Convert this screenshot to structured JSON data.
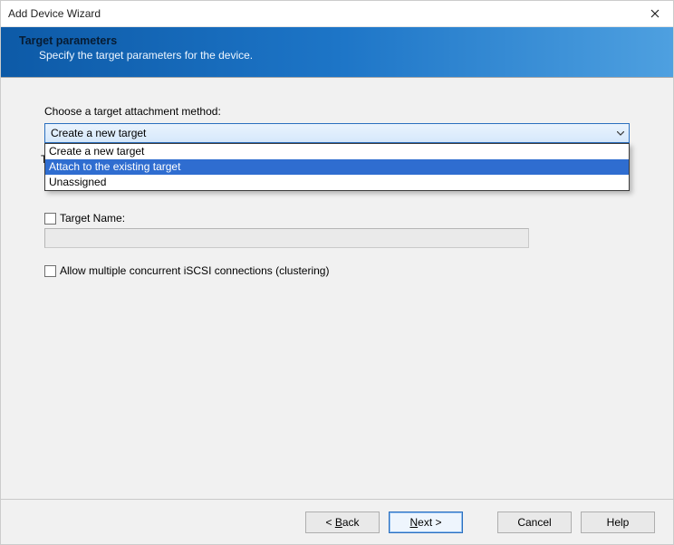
{
  "window": {
    "title": "Add Device Wizard"
  },
  "banner": {
    "heading": "Target parameters",
    "sub": "Specify the target parameters for the device."
  },
  "main": {
    "method_label": "Choose a target attachment method:",
    "method_selected": "Create a new target",
    "method_options": [
      "Create a new target",
      "Attach to the existing target",
      "Unassigned"
    ],
    "method_highlight_index": 1,
    "under_letter": "T",
    "target_name_label": "Target Name:",
    "target_name_value": "",
    "target_name_checked": false,
    "cluster_label": "Allow multiple concurrent iSCSI connections (clustering)",
    "cluster_checked": false
  },
  "footer": {
    "back": "< Back",
    "next": "Next >",
    "cancel": "Cancel",
    "help": "Help"
  }
}
